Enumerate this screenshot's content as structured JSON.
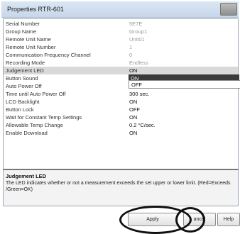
{
  "window": {
    "title": "Properties RTR-601"
  },
  "properties": [
    {
      "name": "Serial Number",
      "value": "5E7E",
      "style": "gray"
    },
    {
      "name": "Group Name",
      "value": "Group1",
      "style": "gray"
    },
    {
      "name": "Remote Unit Name",
      "value": "Unit01",
      "style": "gray"
    },
    {
      "name": "Remote Unit Number",
      "value": "1",
      "style": "gray"
    },
    {
      "name": "Communication Frequency Channel",
      "value": "0",
      "style": "gray"
    },
    {
      "name": "Recording Mode",
      "value": "Endless",
      "style": "gray"
    },
    {
      "name": "Judgement LED",
      "value": "ON",
      "style": "selected"
    },
    {
      "name": "Button Sound",
      "value": "",
      "style": "dark"
    },
    {
      "name": "Auto Power Off",
      "value": "",
      "style": "dark"
    },
    {
      "name": "Time until Auto Power Off",
      "value": "300 sec.",
      "style": "dark"
    },
    {
      "name": "LCD Backlight",
      "value": "ON",
      "style": "dark"
    },
    {
      "name": "Button Lock",
      "value": "OFF",
      "style": "dark"
    },
    {
      "name": "Wait for Constant Temp Settings",
      "value": "ON",
      "style": "dark"
    },
    {
      "name": "Allowable Temp Change",
      "value": "0.2 °C/sec.",
      "style": "dark"
    },
    {
      "name": "Enable Download",
      "value": "ON",
      "style": "dark"
    }
  ],
  "dropdown": {
    "options": [
      "ON",
      "OFF"
    ],
    "highlighted": "ON"
  },
  "description": {
    "title": "Judgement LED",
    "text": "The LED indicates whether or not a measurement exceeds the set upper or lower limit. (Red=Exceeds /Green=OK)"
  },
  "buttons": {
    "apply": "Apply",
    "cancel": "ancel",
    "help": "Help"
  }
}
